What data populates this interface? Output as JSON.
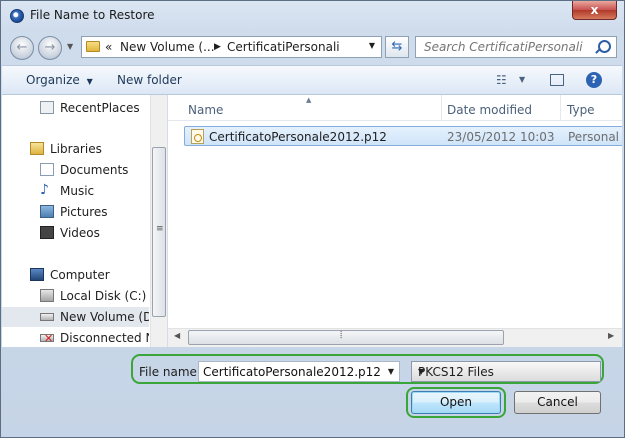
{
  "window": {
    "title": "File Name to Restore",
    "close_label": "x"
  },
  "navbar": {
    "back_glyph": "←",
    "forward_glyph": "→",
    "breadcrumb_prefix": "«",
    "breadcrumb": [
      "New Volume (...",
      "CertificatiPersonali"
    ],
    "search_placeholder": "Search CertificatiPersonali"
  },
  "toolbar": {
    "organize_label": "Organize",
    "new_folder_label": "New folder"
  },
  "sidebar": {
    "items": [
      {
        "label": "RecentPlaces",
        "icon": "recent-places-icon"
      },
      {
        "label": "Libraries",
        "icon": "libraries-icon"
      },
      {
        "label": "Documents",
        "icon": "documents-icon"
      },
      {
        "label": "Music",
        "icon": "music-icon"
      },
      {
        "label": "Pictures",
        "icon": "pictures-icon"
      },
      {
        "label": "Videos",
        "icon": "videos-icon"
      },
      {
        "label": "Computer",
        "icon": "computer-icon"
      },
      {
        "label": "Local Disk (C:)",
        "icon": "local-disk-icon"
      },
      {
        "label": "New Volume (D:)",
        "icon": "drive-icon",
        "selected": true
      },
      {
        "label": "Disconnected Ne",
        "icon": "disconnected-drive-icon"
      }
    ]
  },
  "filelist": {
    "columns": [
      "Name",
      "Date modified",
      "Type"
    ],
    "rows": [
      {
        "name": "CertificatoPersonale2012.p12",
        "date": "23/05/2012 10:03",
        "type": "Personal I"
      }
    ]
  },
  "footer": {
    "file_name_label": "File name:",
    "file_name_value": "CertificatoPersonale2012.p12",
    "file_type": "PKCS12 Files",
    "open_label": "Open",
    "cancel_label": "Cancel"
  },
  "colors": {
    "highlight_outline": "#3aa63a",
    "selection": "#cfe4fa"
  }
}
